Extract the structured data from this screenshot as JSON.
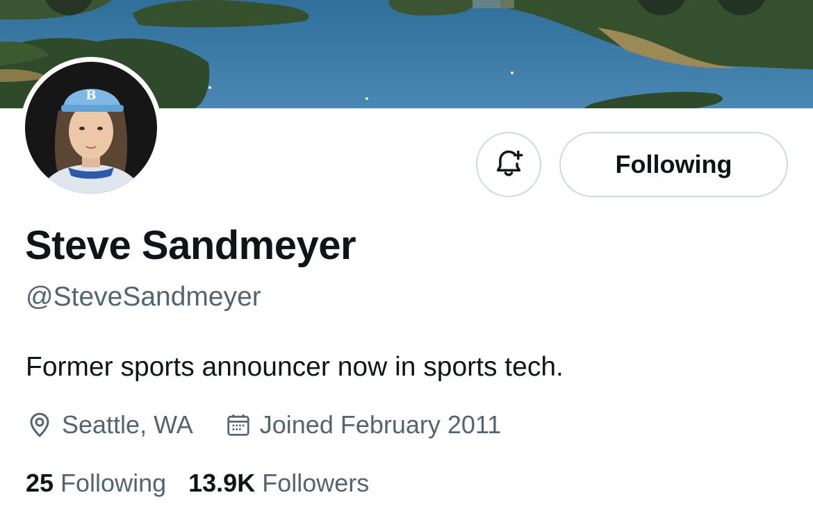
{
  "profile": {
    "display_name": "Steve Sandmeyer",
    "handle": "@SteveSandmeyer",
    "bio": "Former sports announcer now in sports tech.",
    "location": "Seattle, WA",
    "joined": "Joined February 2011"
  },
  "actions": {
    "follow_label": "Following"
  },
  "stats": {
    "following_count": "25",
    "following_label": "Following",
    "followers_count": "13.9K",
    "followers_label": "Followers"
  },
  "icons": {
    "notify": "bell-plus-icon",
    "location": "map-pin-icon",
    "joined": "calendar-icon"
  },
  "colors": {
    "text_primary": "#0f1419",
    "text_secondary": "#536471",
    "border": "#cfd9de",
    "banner_water": "#3f7fa8"
  }
}
